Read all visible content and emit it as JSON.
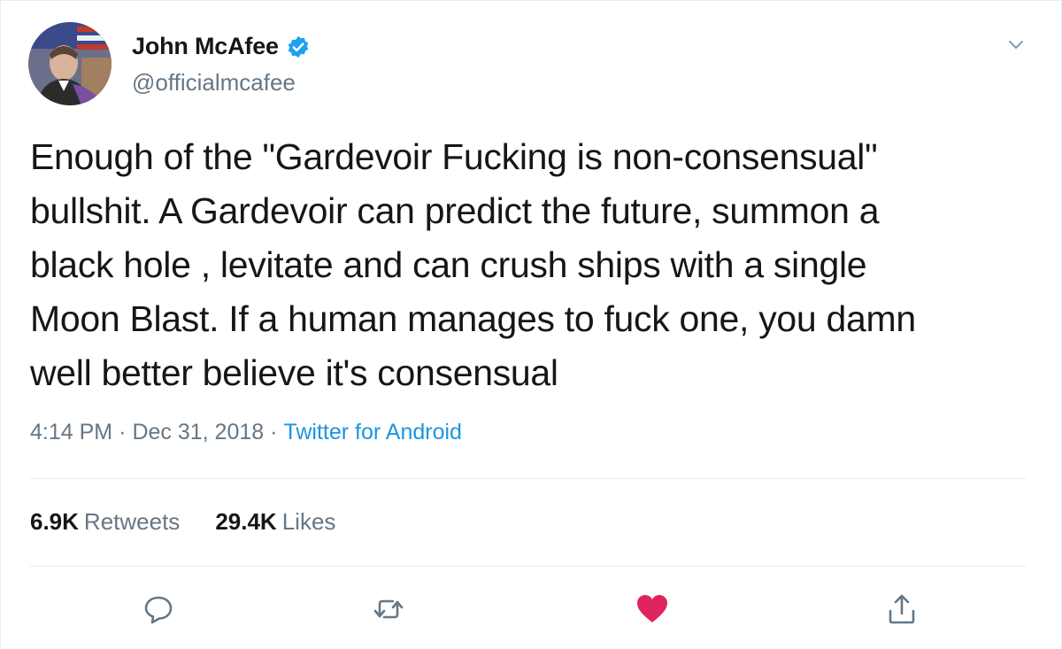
{
  "user": {
    "display_name": "John McAfee",
    "handle": "@officialmcafee",
    "verified": true
  },
  "tweet": {
    "text": "Enough of the \"Gardevoir Fucking is non-consensual\"\nbullshit. A Gardevoir can predict the future, summon a\nblack hole , levitate and can crush ships with a single\nMoon Blast. If a human manages to fuck one, you damn\nwell better believe it's consensual",
    "time": "4:14 PM",
    "date": "Dec 31, 2018",
    "separator": "·",
    "source": "Twitter for Android"
  },
  "stats": {
    "retweets_count": "6.9K",
    "retweets_label": "Retweets",
    "likes_count": "29.4K",
    "likes_label": "Likes"
  },
  "icons": {
    "reply": "reply-icon",
    "retweet": "retweet-icon",
    "like": "heart-icon",
    "share": "share-icon",
    "menu": "chevron-down-icon",
    "verified": "verified-badge-icon"
  },
  "colors": {
    "verified_blue": "#1da1f2",
    "link_blue": "#1b95e0",
    "like_red": "#e0245e",
    "secondary_gray": "#657786",
    "text_dark": "#14171a"
  }
}
